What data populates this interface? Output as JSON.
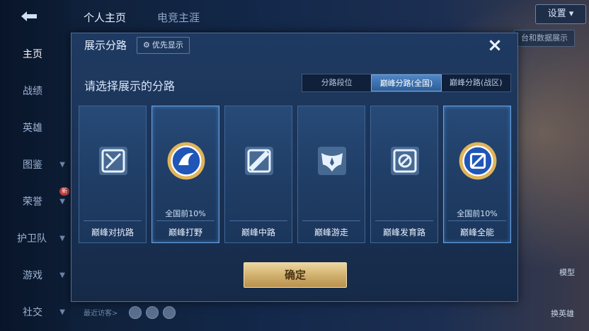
{
  "nav": {
    "items": [
      {
        "label": "主页",
        "active": true,
        "chevron": false
      },
      {
        "label": "战绩",
        "active": false,
        "chevron": false
      },
      {
        "label": "英雄",
        "active": false,
        "chevron": false
      },
      {
        "label": "图鉴",
        "active": false,
        "chevron": true
      },
      {
        "label": "荣誉",
        "active": false,
        "chevron": true,
        "badge": "新"
      },
      {
        "label": "护卫队",
        "active": false,
        "chevron": true
      },
      {
        "label": "游戏",
        "active": false,
        "chevron": true
      },
      {
        "label": "社交",
        "active": false,
        "chevron": true
      }
    ]
  },
  "top_tabs": [
    "个人主页",
    "电竞主涯"
  ],
  "settings_label": "设置",
  "bg_button_label": "台和数据展示",
  "recent_visitors": "最近访客>",
  "side_buttons": [
    "模型",
    "换英雄"
  ],
  "dialog": {
    "title": "展示分路",
    "priority_label": "优先显示",
    "close_icon": "×",
    "prompt": "请选择展示的分路",
    "segments": [
      {
        "label": "分路段位",
        "selected": false
      },
      {
        "label": "巅峰分路(全国)",
        "selected": true
      },
      {
        "label": "巅峰分路(战区)",
        "selected": false
      }
    ],
    "cards": [
      {
        "name": "巅峰对抗路",
        "rank": "",
        "icon": "sword-icon",
        "highlight": false
      },
      {
        "name": "巅峰打野",
        "rank": "全国前10%",
        "icon": "jungle-emblem-icon",
        "highlight": true
      },
      {
        "name": "巅峰中路",
        "rank": "",
        "icon": "mid-lane-icon",
        "highlight": false
      },
      {
        "name": "巅峰游走",
        "rank": "",
        "icon": "wings-icon",
        "highlight": false
      },
      {
        "name": "巅峰发育路",
        "rank": "",
        "icon": "marksman-icon",
        "highlight": false
      },
      {
        "name": "巅峰全能",
        "rank": "全国前10%",
        "icon": "all-round-emblem-icon",
        "highlight": true
      }
    ],
    "confirm_label": "确定"
  },
  "colors": {
    "accent_blue": "#4f86c6",
    "confirm_gold": "#cfae6b",
    "dialog_bg": "#1f3a62"
  }
}
